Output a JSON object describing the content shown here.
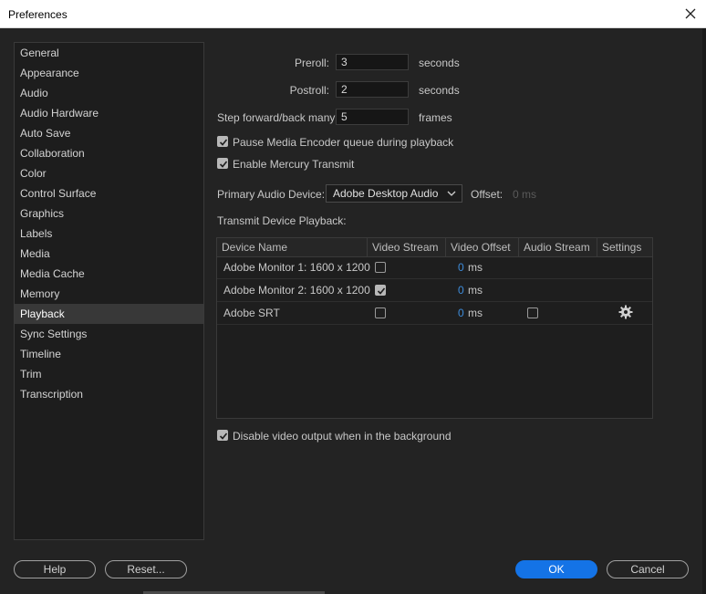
{
  "window": {
    "title": "Preferences"
  },
  "sidebar": {
    "items": [
      {
        "label": "General"
      },
      {
        "label": "Appearance"
      },
      {
        "label": "Audio"
      },
      {
        "label": "Audio Hardware"
      },
      {
        "label": "Auto Save"
      },
      {
        "label": "Collaboration"
      },
      {
        "label": "Color"
      },
      {
        "label": "Control Surface"
      },
      {
        "label": "Graphics"
      },
      {
        "label": "Labels"
      },
      {
        "label": "Media"
      },
      {
        "label": "Media Cache"
      },
      {
        "label": "Memory"
      },
      {
        "label": "Playback",
        "selected": true
      },
      {
        "label": "Sync Settings"
      },
      {
        "label": "Timeline"
      },
      {
        "label": "Trim"
      },
      {
        "label": "Transcription"
      }
    ]
  },
  "playback": {
    "preroll": {
      "label": "Preroll:",
      "value": "3",
      "unit": "seconds"
    },
    "postroll": {
      "label": "Postroll:",
      "value": "2",
      "unit": "seconds"
    },
    "step": {
      "label": "Step forward/back many:",
      "value": "5",
      "unit": "frames"
    },
    "pause_encoder": {
      "label": "Pause Media Encoder queue during playback",
      "checked": true
    },
    "mercury": {
      "label": "Enable Mercury Transmit",
      "checked": true
    },
    "audio_device": {
      "label": "Primary Audio Device:",
      "value": "Adobe Desktop Audio"
    },
    "offset": {
      "label": "Offset:",
      "value": "0 ms"
    },
    "transmit_label": "Transmit Device Playback:",
    "table": {
      "headers": [
        "Device Name",
        "Video Stream",
        "Video Offset",
        "Audio Stream",
        "Settings"
      ],
      "rows": [
        {
          "name": "Adobe Monitor 1: 1600 x 1200",
          "video_stream": false,
          "offset": "0",
          "unit": "ms",
          "audio_stream": null,
          "settings": false
        },
        {
          "name": "Adobe Monitor 2: 1600 x 1200",
          "video_stream": true,
          "offset": "0",
          "unit": "ms",
          "audio_stream": null,
          "settings": false
        },
        {
          "name": "Adobe SRT",
          "video_stream": false,
          "offset": "0",
          "unit": "ms",
          "audio_stream": false,
          "settings": true
        }
      ]
    },
    "disable_bg": {
      "label": "Disable video output when in the background",
      "checked": true
    }
  },
  "buttons": {
    "help": "Help",
    "reset": "Reset...",
    "ok": "OK",
    "cancel": "Cancel"
  },
  "colors": {
    "accent": "#1473e6",
    "value_blue": "#3d8bd9"
  },
  "icons": {
    "close": "close-icon",
    "settings": "gear-icon",
    "dropdown": "chevron-down-icon",
    "check": "checkmark-icon"
  }
}
